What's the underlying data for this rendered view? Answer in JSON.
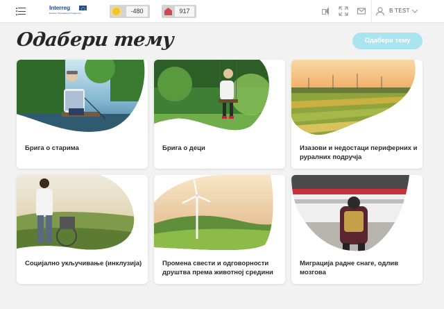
{
  "header": {
    "logo": {
      "brand": "Interreg",
      "subtitle": "Danube Transnational Programme"
    },
    "stats": [
      {
        "icon": "sun-icon",
        "value": "-480",
        "color": "#f1c232"
      },
      {
        "icon": "house-icon",
        "value": "917",
        "color": "#d64552"
      }
    ],
    "icons": [
      "speaker-icon",
      "expand-icon",
      "mail-icon",
      "user-icon",
      "chevron-down-icon"
    ],
    "user_label": "B TEST"
  },
  "page": {
    "title": "Одабери тему",
    "choose_button": "Одабери тему",
    "accent_color": "#a9e4f1"
  },
  "topics": [
    {
      "title": "Брига о старима",
      "image": "elderly man fishing by lake"
    },
    {
      "title": "Брига о деци",
      "image": "child on swing in forest"
    },
    {
      "title": "Изазови и недостаци периферних и руралних подручја",
      "image": "rural landscape with wind turbines at sunset"
    },
    {
      "title": "Социјално укључивање (инклузија)",
      "image": "woman with wheelchair user outdoors"
    },
    {
      "title": "Промена свести и одговорности друштва према животној средини",
      "image": "wind turbine on green hills"
    },
    {
      "title": "Миграција радне снаге, одлив мозгова",
      "image": "person with backpack at train station"
    }
  ]
}
